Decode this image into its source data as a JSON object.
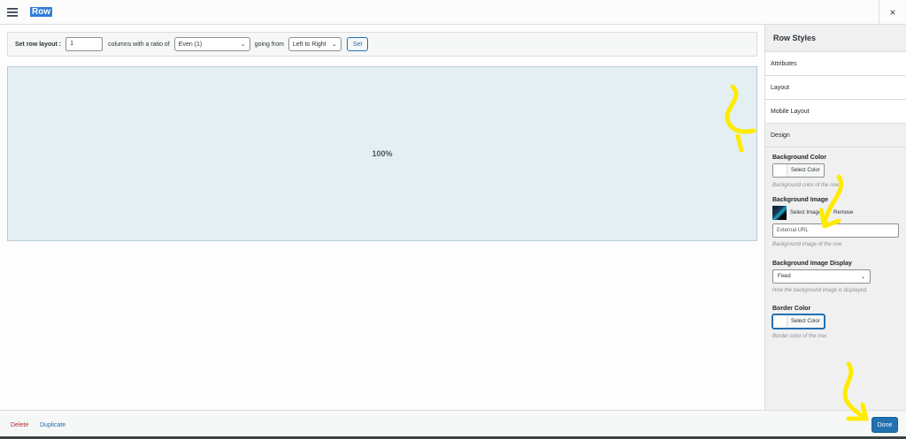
{
  "header": {
    "menu_icon": "hamburger-icon",
    "title": "Row",
    "close_glyph": "×"
  },
  "toolbar": {
    "set_row_layout_label": "Set row layout :",
    "columns_value": "1",
    "columns_text": "columns with a ratio of",
    "ratio_selected": "Even (1)",
    "going_from_text": "going from",
    "direction_selected": "Left to Right",
    "set_label": "Set"
  },
  "canvas": {
    "cell_label": "100%"
  },
  "sidebar": {
    "title": "Row Styles",
    "sections": [
      "Attributes",
      "Layout",
      "Mobile Layout",
      "Design"
    ],
    "active_section": "Design",
    "design": {
      "bg_color": {
        "title": "Background Color",
        "button": "Select Color",
        "desc": "Background color of the row."
      },
      "bg_image": {
        "title": "Background Image",
        "select": "Select Image",
        "remove": "Remove",
        "url_placeholder": "External URL",
        "desc": "Background image of the row."
      },
      "bg_display": {
        "title": "Background Image Display",
        "selected": "Fixed",
        "desc": "How the background image is displayed."
      },
      "border_color": {
        "title": "Border Color",
        "button": "Select Color",
        "desc": "Border color of the row."
      }
    }
  },
  "footer": {
    "delete": "Delete",
    "duplicate": "Duplicate",
    "done": "Done"
  },
  "colors": {
    "accent": "#2271b1",
    "delete": "#b32d2e",
    "cell_bg": "#e4eff4",
    "annotation": "#ffeb00"
  }
}
